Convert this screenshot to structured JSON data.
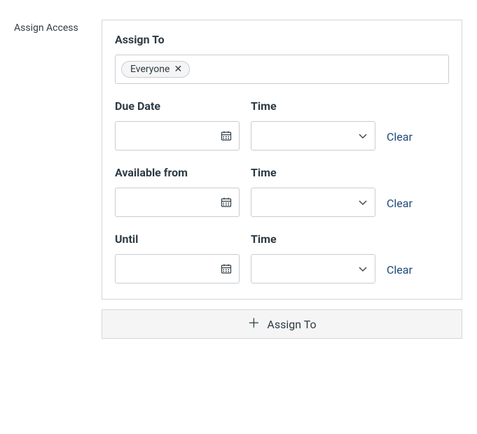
{
  "sideLabel": "Assign Access",
  "assignTo": {
    "label": "Assign To",
    "tags": [
      {
        "text": "Everyone"
      }
    ]
  },
  "rows": [
    {
      "dateLabel": "Due Date",
      "timeLabel": "Time",
      "clearLabel": "Clear",
      "dateValue": "",
      "timeValue": ""
    },
    {
      "dateLabel": "Available from",
      "timeLabel": "Time",
      "clearLabel": "Clear",
      "dateValue": "",
      "timeValue": ""
    },
    {
      "dateLabel": "Until",
      "timeLabel": "Time",
      "clearLabel": "Clear",
      "dateValue": "",
      "timeValue": ""
    }
  ],
  "addButton": {
    "label": "Assign To"
  }
}
